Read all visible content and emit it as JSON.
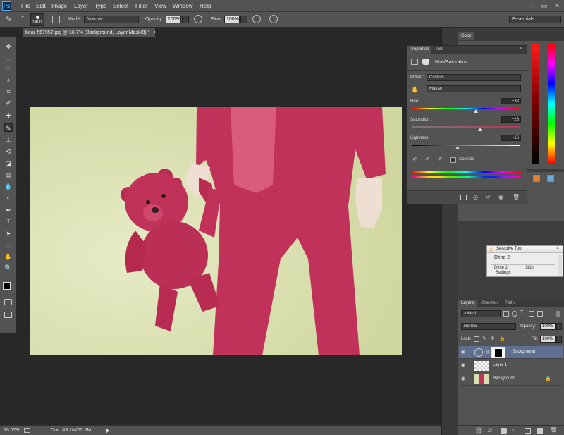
{
  "menubar": {
    "logo": "Ps",
    "items": [
      "File",
      "Edit",
      "Image",
      "Layer",
      "Type",
      "Select",
      "Filter",
      "View",
      "Window",
      "Help"
    ],
    "window_buttons": [
      "–",
      "▭",
      "✕"
    ]
  },
  "options_bar": {
    "brush_size": "1400",
    "mode_label": "Mode:",
    "mode_value": "Normal",
    "opacity_label": "Opacity:",
    "opacity_value": "100%",
    "flow_label": "Flow:",
    "flow_value": "100%",
    "workspace": "Essentials"
  },
  "document": {
    "tab_title": "bear-567952.jpg @ 16.7% (Background, Layer Mask/8) *",
    "close": "×"
  },
  "status": {
    "zoom": "16.67%",
    "doc": "Doc: 49.1M/55.5M"
  },
  "color_panel": {
    "tab": "Color"
  },
  "properties": {
    "tabs": [
      "Properties",
      "Info"
    ],
    "title": "Hue/Saturation",
    "preset_label": "Preset:",
    "preset_value": "Custom",
    "channel_value": "Master",
    "hue_label": "Hue:",
    "hue_value": "+33",
    "hue_level": 0.59,
    "saturation_label": "Saturation:",
    "saturation_value": "+26",
    "saturation_level": 0.63,
    "lightness_label": "Lightness:",
    "lightness_value": "-16",
    "lightness_level": 0.42,
    "colorize_label": "Colorize"
  },
  "selective_tool": {
    "title": "Selective Tool",
    "item": "Dfine 2",
    "sub_item": "Dfine 2",
    "skip": "Skip",
    "settings": "Settings"
  },
  "layers": {
    "tabs": [
      "Layers",
      "Channels",
      "Paths"
    ],
    "kind": "Kind",
    "blend": "Normal",
    "opacity_label": "Opacity:",
    "opacity_value": "100%",
    "lock_label": "Lock:",
    "fill_label": "Fill:",
    "fill_value": "100%",
    "rows": [
      {
        "name": "Background",
        "type": "adjustment",
        "selected": true
      },
      {
        "name": "Layer 1",
        "type": "transparent",
        "selected": false
      },
      {
        "name": "Background",
        "type": "photo",
        "selected": false,
        "italic": true
      }
    ]
  },
  "colors": {
    "menubar": "#535353",
    "workspace": "#282828",
    "photo_background": "#d9dfae",
    "pajama": "#c9365f",
    "selected_layer": "#5f6f8f"
  }
}
